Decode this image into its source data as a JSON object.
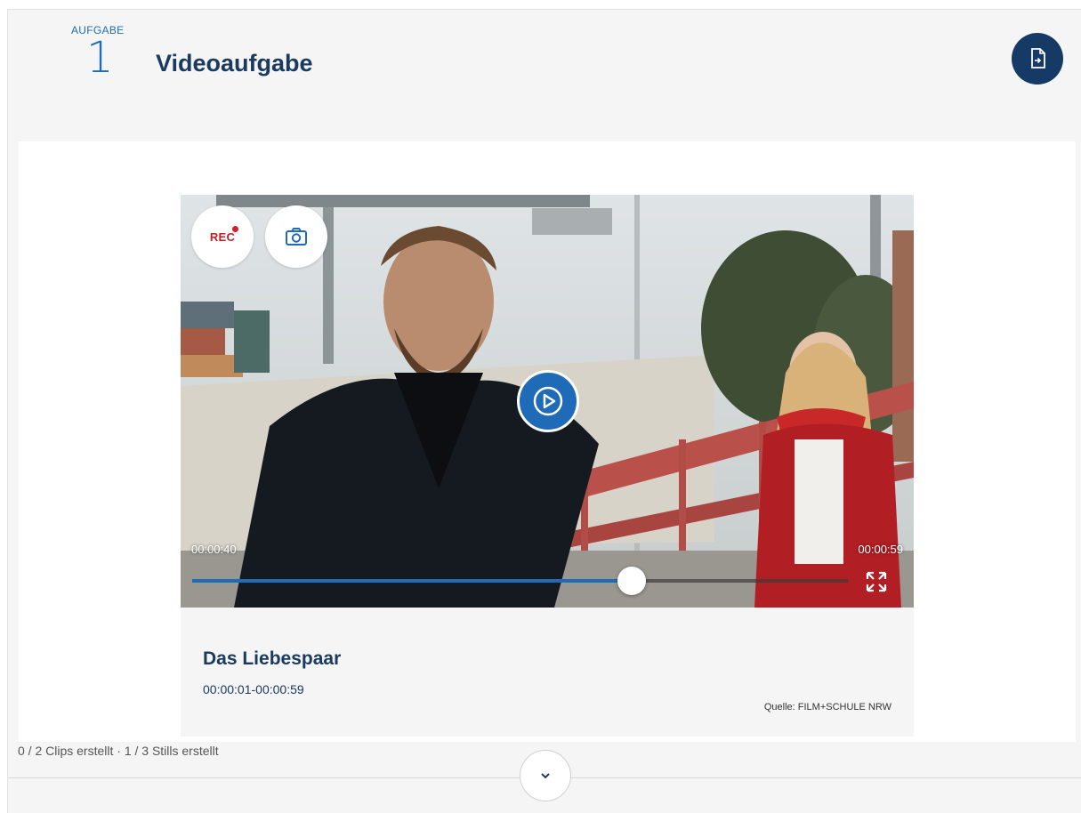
{
  "header": {
    "task_label": "AUFGABE",
    "task_number": "1",
    "title": "Videoaufgabe",
    "export_icon": "document-export-icon"
  },
  "video": {
    "rec_label": "REC",
    "rec_icon": "record-dot-icon",
    "camera_icon": "camera-icon",
    "play_icon": "play-icon",
    "current_time": "00:00:40",
    "end_time": "00:00:59",
    "progress": 0.67,
    "fullscreen_icon": "expand-icon",
    "accent_color": "#1f6bb8"
  },
  "clip": {
    "title": "Das Liebespaar",
    "range": "00:00:01-00:00:59",
    "source": "Quelle: FILM+SCHULE NRW"
  },
  "footer": {
    "status": "0 / 2 Clips erstellt  ·  1 / 3 Stills erstellt",
    "collapse_icon": "chevron-down-icon"
  }
}
